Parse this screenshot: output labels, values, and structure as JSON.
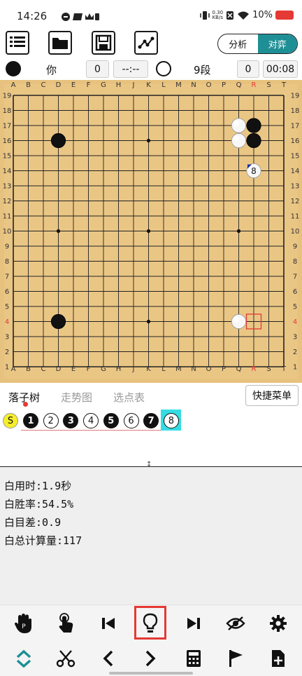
{
  "status_bar": {
    "time": "14:26",
    "net_speed_value": "0.30",
    "net_speed_unit": "KB/s",
    "battery": "10%"
  },
  "toolbar": {
    "mode_analysis": "分析",
    "mode_play": "对弈"
  },
  "players": {
    "black": {
      "name": "你",
      "captures": "0",
      "time": "--:--"
    },
    "white": {
      "name": "9段",
      "captures": "0",
      "time": "00:08"
    }
  },
  "board": {
    "size": 19,
    "col_labels": [
      "A",
      "B",
      "C",
      "D",
      "E",
      "F",
      "G",
      "H",
      "J",
      "K",
      "L",
      "M",
      "N",
      "O",
      "P",
      "Q",
      "R",
      "S",
      "T"
    ],
    "row_labels": [
      "19",
      "18",
      "17",
      "16",
      "15",
      "14",
      "13",
      "12",
      "11",
      "10",
      "9",
      "8",
      "7",
      "6",
      "5",
      "4",
      "3",
      "2",
      "1"
    ],
    "highlight_col": "R",
    "highlight_row": "4",
    "hoshi": [
      "D16",
      "K16",
      "Q16",
      "D10",
      "K10",
      "Q10",
      "D4",
      "K4",
      "Q4"
    ],
    "stones": [
      {
        "color": "black",
        "point": "D16"
      },
      {
        "color": "black",
        "point": "D4"
      },
      {
        "color": "white",
        "point": "Q17"
      },
      {
        "color": "black",
        "point": "R17"
      },
      {
        "color": "white",
        "point": "Q16"
      },
      {
        "color": "black",
        "point": "R16"
      },
      {
        "color": "white",
        "point": "R14",
        "label": "8"
      },
      {
        "color": "white",
        "point": "Q4"
      }
    ],
    "last_move_marker": "R14",
    "suggest_marker": "R4"
  },
  "tabs": {
    "items": [
      "落子树",
      "走势图",
      "选点表"
    ],
    "active": 0,
    "quick_menu": "快捷菜单"
  },
  "move_tree": {
    "start": "S",
    "moves": [
      "1",
      "2",
      "3",
      "4",
      "5",
      "6",
      "7",
      "8"
    ],
    "colors": [
      "b",
      "w",
      "b",
      "w",
      "b",
      "w",
      "b",
      "w"
    ],
    "selected": "8"
  },
  "info": {
    "white_time": "白用时:1.9秒",
    "white_winrate": "白胜率:54.5%",
    "white_score": "白目差:0.9",
    "white_visits": "白总计算量:117"
  },
  "bottom_bar_icons": [
    "hand-pass-icon",
    "touch-hand-icon",
    "first-move-icon",
    "hint-bulb-icon",
    "last-move-icon",
    "hide-eye-icon",
    "settings-gear-icon"
  ],
  "nav_bar_icons": [
    "expand-collapse-icon",
    "scissors-icon",
    "previous-icon",
    "next-icon",
    "calculator-icon",
    "flag-icon",
    "new-file-icon"
  ],
  "accent_color": "#1f8f96",
  "highlight_color": "#e53935"
}
